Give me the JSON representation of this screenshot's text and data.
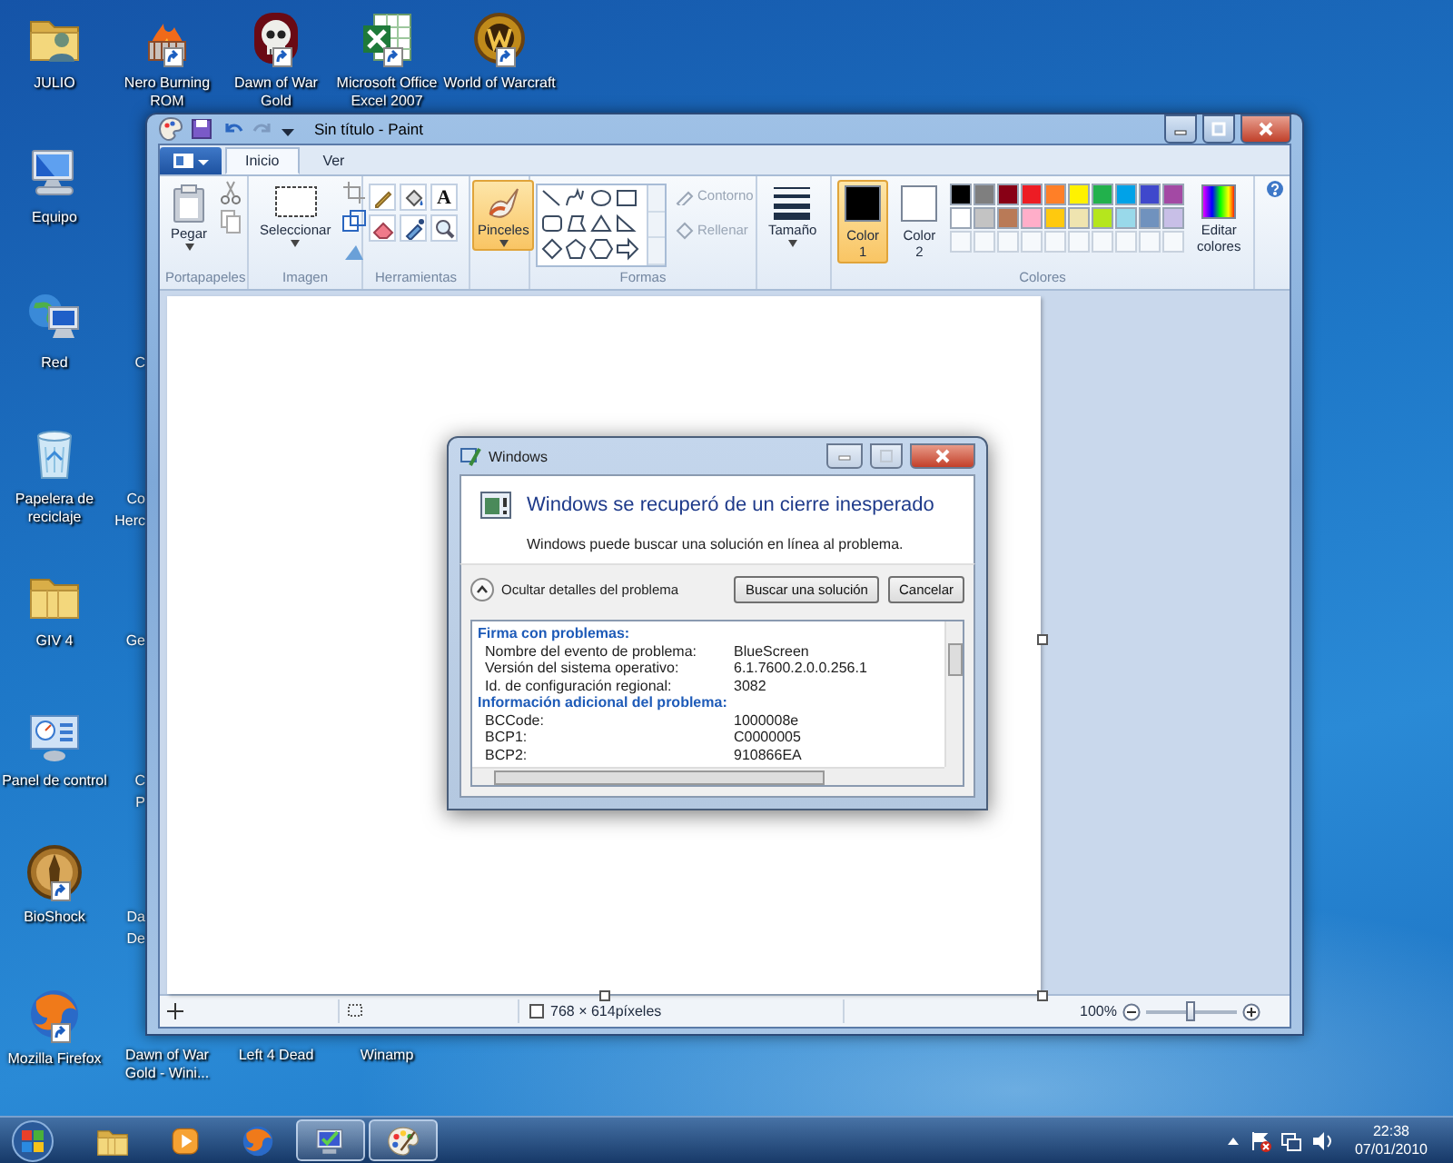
{
  "desktop": {
    "icons": [
      {
        "label": "JULIO",
        "kind": "user-folder",
        "shortcut": false
      },
      {
        "label": "Nero Burning ROM",
        "kind": "flame",
        "shortcut": true
      },
      {
        "label": "Dawn of War Gold",
        "kind": "skull",
        "shortcut": true
      },
      {
        "label": "Microsoft Office Excel 2007",
        "kind": "spreadsheet",
        "shortcut": true
      },
      {
        "label": "World of Warcraft",
        "kind": "emblem",
        "shortcut": true
      },
      {
        "label": "Equipo",
        "kind": "computer",
        "shortcut": false
      },
      {
        "label": "Red",
        "kind": "network",
        "shortcut": false
      },
      {
        "label": "Papelera de reciclaje",
        "kind": "recycle",
        "shortcut": false
      },
      {
        "label": "GIV 4",
        "kind": "folder",
        "shortcut": false
      },
      {
        "label": "Panel de control",
        "kind": "control-panel",
        "shortcut": false
      },
      {
        "label": "BioShock",
        "kind": "medallion",
        "shortcut": true
      },
      {
        "label": "Mozilla Firefox",
        "kind": "browser",
        "shortcut": true
      },
      {
        "label": "Dawn of War Gold - Wini...",
        "kind": "covered",
        "shortcut": false
      },
      {
        "label": "Left 4 Dead",
        "kind": "covered",
        "shortcut": false
      },
      {
        "label": "Winamp",
        "kind": "covered",
        "shortcut": false
      }
    ],
    "covered_labels": [
      "C",
      "Co",
      "Herc",
      "Ge",
      "C",
      "P",
      "Da",
      "De"
    ]
  },
  "paint": {
    "title": "Sin título - Paint",
    "tabs": [
      {
        "label": "Inicio",
        "selected": true
      },
      {
        "label": "Ver",
        "selected": false
      }
    ],
    "clipboard": {
      "paste": "Pegar",
      "label": "Portapapeles"
    },
    "image": {
      "select": "Seleccionar",
      "label": "Imagen"
    },
    "tools": {
      "text_tool": "A",
      "label": "Herramientas"
    },
    "brushes": {
      "label": "Pinceles",
      "selected": true
    },
    "shapes": {
      "outline": "Contorno",
      "fill": "Rellenar",
      "disabled": true,
      "label": "Formas"
    },
    "size": {
      "label": "Tamaño"
    },
    "colors": {
      "slots": [
        {
          "label": "Color",
          "number": "1",
          "color": "#000000",
          "selected": true
        },
        {
          "label": "Color",
          "number": "2",
          "color": "#ffffff",
          "selected": false
        }
      ],
      "palette": [
        {
          "color": "#000000"
        },
        {
          "color": "#7f7f7f"
        },
        {
          "color": "#880015"
        },
        {
          "color": "#ed1c24"
        },
        {
          "color": "#ff7f27"
        },
        {
          "color": "#fff200"
        },
        {
          "color": "#22b14c"
        },
        {
          "color": "#00a2e8"
        },
        {
          "color": "#3f48cc"
        },
        {
          "color": "#a349a4"
        },
        {
          "color": "#ffffff"
        },
        {
          "color": "#c3c3c3"
        },
        {
          "color": "#b97a57"
        },
        {
          "color": "#ffaec9"
        },
        {
          "color": "#ffc90e"
        },
        {
          "color": "#efe4b0"
        },
        {
          "color": "#b5e61d"
        },
        {
          "color": "#99d9ea"
        },
        {
          "color": "#7092be"
        },
        {
          "color": "#c8bfe7"
        }
      ],
      "edit": "Editar colores",
      "label": "Colores"
    },
    "status": {
      "dimensions": "768 × 614píxeles",
      "zoom": {
        "reading": "100%",
        "level": 0.5
      }
    }
  },
  "dialog": {
    "title": "Windows",
    "heading": "Windows se recuperó de un cierre inesperado",
    "message": "Windows puede buscar una solución en línea al problema.",
    "details_toggle": {
      "label": "Ocultar detalles del problema",
      "expanded": true
    },
    "buttons": [
      "Buscar una solución",
      "Cancelar"
    ],
    "sections": [
      {
        "heading": "Firma con problemas:",
        "rows": [
          {
            "name": "Nombre del evento de problema:",
            "value": "BlueScreen"
          },
          {
            "name": "Versión del sistema operativo:",
            "value": "6.1.7600.2.0.0.256.1"
          },
          {
            "name": "Id. de configuración regional:",
            "value": "3082"
          }
        ]
      },
      {
        "heading": "Información adicional del problema:",
        "rows": [
          {
            "name": "BCCode:",
            "value": "1000008e"
          },
          {
            "name": "BCP1:",
            "value": "C0000005"
          },
          {
            "name": "BCP2:",
            "value": "910866EA"
          }
        ]
      }
    ]
  },
  "taskbar": {
    "items": [
      {
        "kind": "folder",
        "active": false
      },
      {
        "kind": "media",
        "active": false
      },
      {
        "kind": "browser",
        "active": false
      },
      {
        "kind": "report",
        "active": true
      },
      {
        "kind": "paint",
        "active": true
      }
    ],
    "clock": {
      "time": "22:38",
      "date": "07/01/2010"
    }
  }
}
